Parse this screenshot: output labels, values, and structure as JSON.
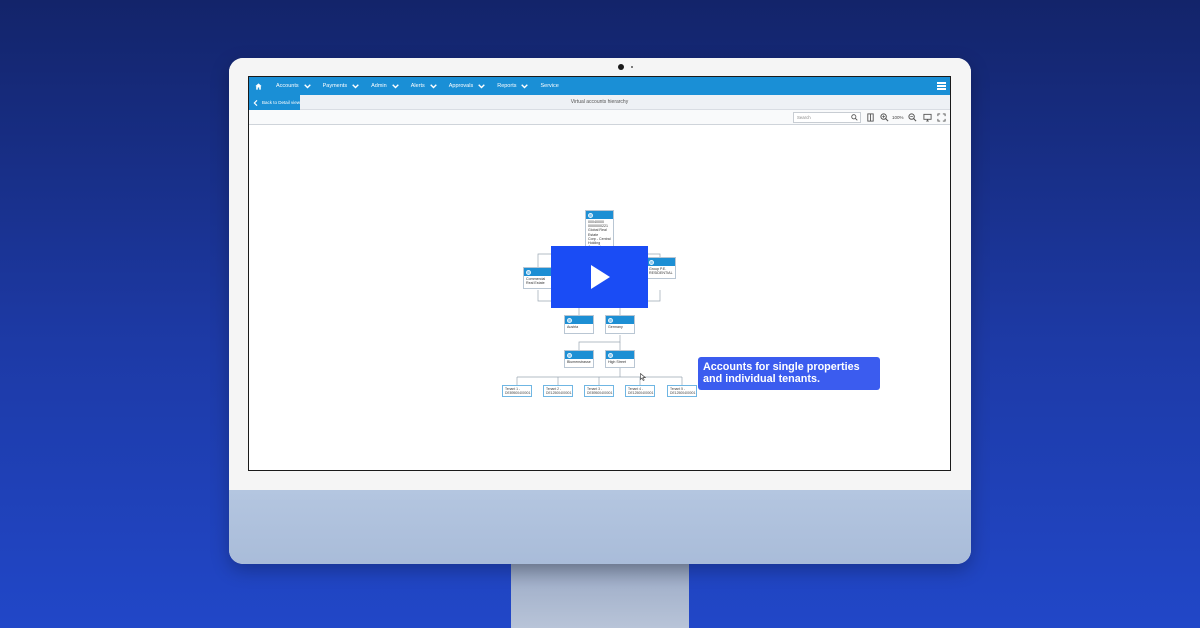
{
  "topnav": {
    "items": [
      {
        "label": "Accounts"
      },
      {
        "label": "Payments"
      },
      {
        "label": "Admin"
      },
      {
        "label": "Alerts"
      },
      {
        "label": "Approvals"
      },
      {
        "label": "Reports"
      },
      {
        "label": "Service"
      }
    ]
  },
  "subheader": {
    "back_label": "Back to Detail view",
    "title": "Virtual accounts hierarchy"
  },
  "toolbar": {
    "search_placeholder": "Search",
    "zoom_level": "100%"
  },
  "diagram": {
    "root": {
      "text": "00040000\n0000000221\nGlobal Real\nEstate\nCorp - Central\nHolding Account"
    },
    "left_branch": {
      "text": "Commercial\nReal Estate"
    },
    "right_branch": {
      "text": "Group P.E.\nRESIDENTIAL"
    },
    "countries": [
      {
        "text": "Austria"
      },
      {
        "text": "Germany"
      }
    ],
    "properties": [
      {
        "text": "Blumenstrasse"
      },
      {
        "text": "High Street"
      }
    ],
    "tenants": [
      {
        "text": "Tenant 1 -\nDE89500400001"
      },
      {
        "text": "Tenant 2 -\nDE12500400001"
      },
      {
        "text": "Tenant 3 -\nDE89500400001"
      },
      {
        "text": "Tenant 4 -\nDE12500400001"
      },
      {
        "text": "Tenant 5 -\nDE12500400001"
      }
    ]
  },
  "overlay": {
    "callout": "Accounts for single properties and individual tenants."
  },
  "colors": {
    "nav": "#1a8fd6",
    "play": "#1a4cf5",
    "callout": "#3b5cef",
    "background_top": "#13246a",
    "background_bottom": "#2147c8"
  }
}
